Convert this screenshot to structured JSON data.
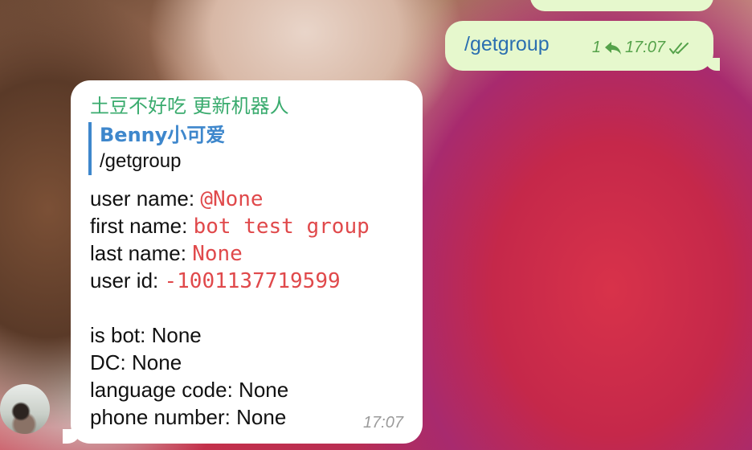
{
  "chat": {
    "outgoing": {
      "text": "/getgroup",
      "reply_count": "1",
      "time": "17:07",
      "icons": {
        "reply": "reply-arrow-icon",
        "status": "double-check-icon"
      },
      "bubble_color": "#e6f8cd"
    },
    "incoming": {
      "sender": "土豆不好吃 更新机器人",
      "quote": {
        "name": "Benny小可爱",
        "text": "/getgroup"
      },
      "fields": {
        "user_name_label": "user name:",
        "user_name_value": "@None",
        "first_name_label": "first name:",
        "first_name_value": "bot test group",
        "last_name_label": "last name:",
        "last_name_value": "None",
        "user_id_label": "user id:",
        "user_id_value": "-1001137719599",
        "is_bot": "is bot: None",
        "dc": "DC: None",
        "language_code": "language code: None",
        "phone_number": "phone number: None"
      },
      "time": "17:07",
      "colors": {
        "sender": "#3aab6e",
        "quote": "#3e87cc",
        "code": "#e0494b"
      }
    }
  }
}
